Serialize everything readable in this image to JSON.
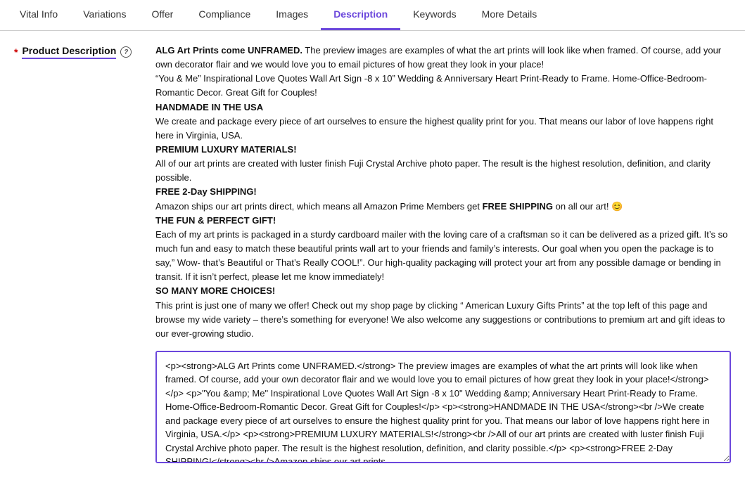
{
  "tabs": [
    {
      "id": "vital-info",
      "label": "Vital Info",
      "active": false
    },
    {
      "id": "variations",
      "label": "Variations",
      "active": false
    },
    {
      "id": "offer",
      "label": "Offer",
      "active": false
    },
    {
      "id": "compliance",
      "label": "Compliance",
      "active": false
    },
    {
      "id": "images",
      "label": "Images",
      "active": false
    },
    {
      "id": "description",
      "label": "Description",
      "active": true
    },
    {
      "id": "keywords",
      "label": "Keywords",
      "active": false
    },
    {
      "id": "more-details",
      "label": "More Details",
      "active": false
    }
  ],
  "field": {
    "required_star": "*",
    "label": "Product Description",
    "help_icon": "?",
    "description_html": "<p><strong>ALG Art Prints come UNFRAMED.</strong> The preview images are examples of what the art prints will look like when framed. Of course, add your own decorator flair and we would love you to email pictures of how great they look in your place!</strong></p> <p>&ldquo;You &amp; Me&rdquo; Inspirational Love Quotes Wall Art Sign -8 x 10&rdquo; Wedding &amp; Anniversary Heart Print-Ready to Frame. Home-Office-Bedroom-Romantic Decor. Great Gift for Couples!</p> <p><strong>HANDMADE IN THE USA</strong><br />We create and package every piece of art ourselves to ensure the highest quality print for you. That means our labor of love happens right here in Virginia, USA.</p> <p><strong>PREMIUM LUXURY MATERIALS!</strong><br />All of our art prints are created with luster finish Fuji Crystal Archive photo paper. The result is the highest resolution, definition, and clarity possible.</p> <p><strong>FREE 2-Day SHIPPING!</strong><br />Amazon ships our art prints direct, which means all Amazon Prime Members get <strong>FREE SHIPPING</strong> on all our art! 😊</p> <p><strong>THE FUN &amp; PERFECT GIFT!</strong><br />Each of my art prints is packaged in a sturdy cardboard mailer with the loving care of a craftsman so it can be delivered as a prized gift. It&rsquo;s so much fun and easy to match these beautiful prints wall art to your friends and family&rsquo;s interests. Our goal when you open the package is to say,&rdquo; Wow- that&rsquo;s Beautiful or That&rsquo;s Really COOL!&rdquo;. Our high-quality packaging will protect your art from any possible damage or bending in transit. If it isn&rsquo;t perfect, please let me know immediately!</p> <p><strong>SO MANY MORE CHOICES!</strong><br />This print is just one of many we offer! Check out my shop page by clicking &ldquo; American Luxury Gifts Prints&rdquo; at the top left of this page and browse my wide variety &ndash; there&rsquo;s something for everyone! We also welcome any suggestions or contributions to premium art and gift ideas to our ever-growing studio.</p>",
    "textarea_value": "<p><strong>ALG Art Prints come UNFRAMED.</strong> The preview images are examples of what the art prints will look like when framed. Of course, add your own decorator flair and we would love you to email pictures of how great they look in your place!</strong></p> <p>\"You &amp; Me\" Inspirational Love Quotes Wall Art Sign -8 x 10\" Wedding &amp; Anniversary Heart Print-Ready to Frame. Home-Office-Bedroom-Romantic Decor. Great Gift for Couples!</p> <p><strong>HANDMADE IN THE USA</strong><br />We create and package every piece of art ourselves to ensure the highest quality print for you. That means our labor of love happens right here in Virginia, USA.</p> <p><strong>PREMIUM LUXURY MATERIALS!</strong><br />All of our art prints are created with luster finish Fuji Crystal Archive photo paper. The result is the highest resolution, definition, and clarity possible.</p> <p><strong>FREE 2-Day SHIPPING!</strong><br />Amazon ships our art prints"
  }
}
